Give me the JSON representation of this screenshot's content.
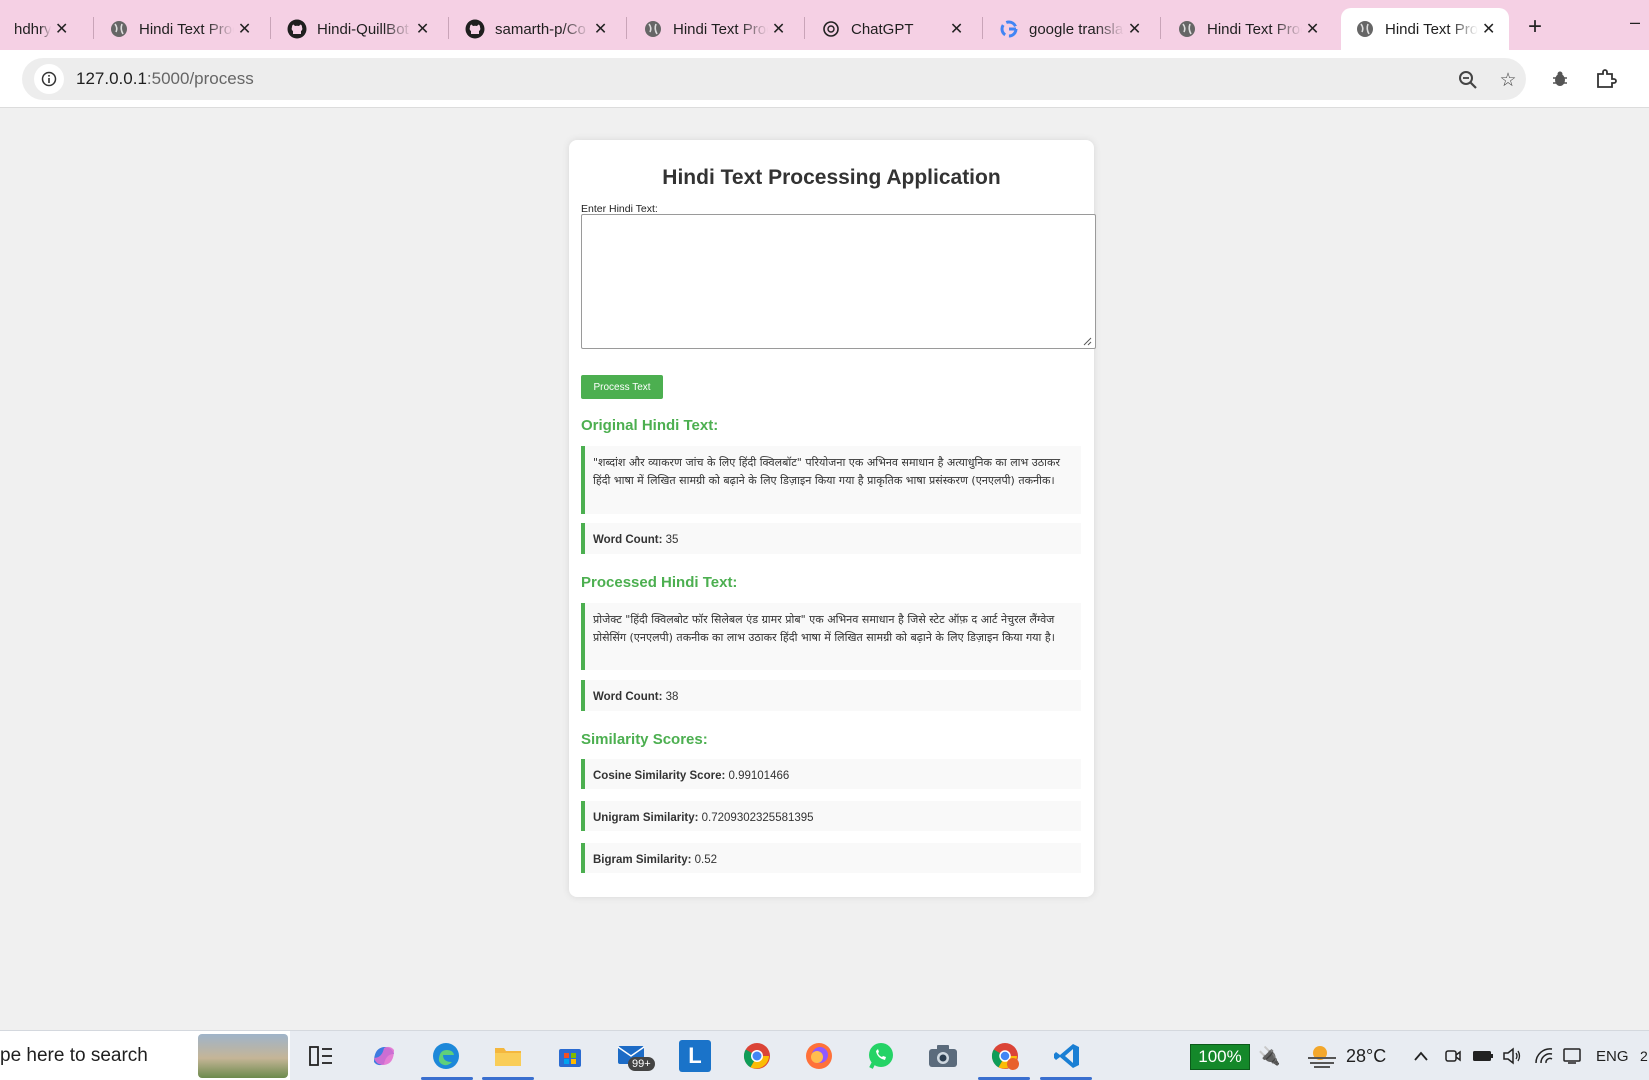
{
  "browser": {
    "tabs": [
      {
        "label": "hdhry/H",
        "favicon": "github-icon"
      },
      {
        "label": "Hindi Text Processing",
        "favicon": "globe-icon"
      },
      {
        "label": "Hindi-QuillBot",
        "favicon": "github-icon"
      },
      {
        "label": "samarth-p/Co",
        "favicon": "github-icon"
      },
      {
        "label": "Hindi Text Processing",
        "favicon": "globe-icon"
      },
      {
        "label": "ChatGPT",
        "favicon": "chatgpt-icon"
      },
      {
        "label": "google translate",
        "favicon": "google-icon"
      },
      {
        "label": "Hindi Text Processing",
        "favicon": "globe-icon"
      },
      {
        "label": "Hindi Text Processing",
        "favicon": "globe-icon"
      }
    ],
    "active_tab_index": 8,
    "url_host": "127.0.0.1",
    "url_path": ":5000/process"
  },
  "app": {
    "title": "Hindi Text Processing Application",
    "input_label": "Enter Hindi Text:",
    "input_value": "",
    "process_button": "Process Text",
    "original_heading": "Original Hindi Text:",
    "original_text": "\"शब्दांश और व्याकरण जांच के लिए हिंदी क्विलबॉट\" परियोजना एक अभिनव समाधान है अत्याधुनिक का लाभ उठाकर हिंदी भाषा में लिखित सामग्री को बढ़ाने के लिए डिज़ाइन किया गया है प्राकृतिक भाषा प्रसंस्करण (एनएलपी) तकनीक।",
    "word_count_label": "Word Count:",
    "original_word_count": "35",
    "processed_heading": "Processed Hindi Text:",
    "processed_text": "प्रोजेक्ट \"हिंदी क्विलबोट फॉर सिलेबल एंड ग्रामर प्रोब\" एक अभिनव समाधान है जिसे स्टेट ऑफ़ द आर्ट नेचुरल लैंग्वेज प्रोसेसिंग (एनएलपी) तकनीक का लाभ उठाकर हिंदी भाषा में लिखित सामग्री को बढ़ाने के लिए डिज़ाइन किया गया है।",
    "processed_word_count": "38",
    "similarity_heading": "Similarity Scores:",
    "cosine_label": "Cosine Similarity Score:",
    "cosine_value": "0.99101466",
    "unigram_label": "Unigram Similarity:",
    "unigram_value": "0.7209302325581395",
    "bigram_label": "Bigram Similarity:",
    "bigram_value": "0.52",
    "accent_color": "#4caf50"
  },
  "taskbar": {
    "search_text": "pe here to search",
    "mail_badge": "99+",
    "battery": "100%",
    "temperature": "28°C",
    "language": "ENG",
    "clock_partial": "2"
  }
}
